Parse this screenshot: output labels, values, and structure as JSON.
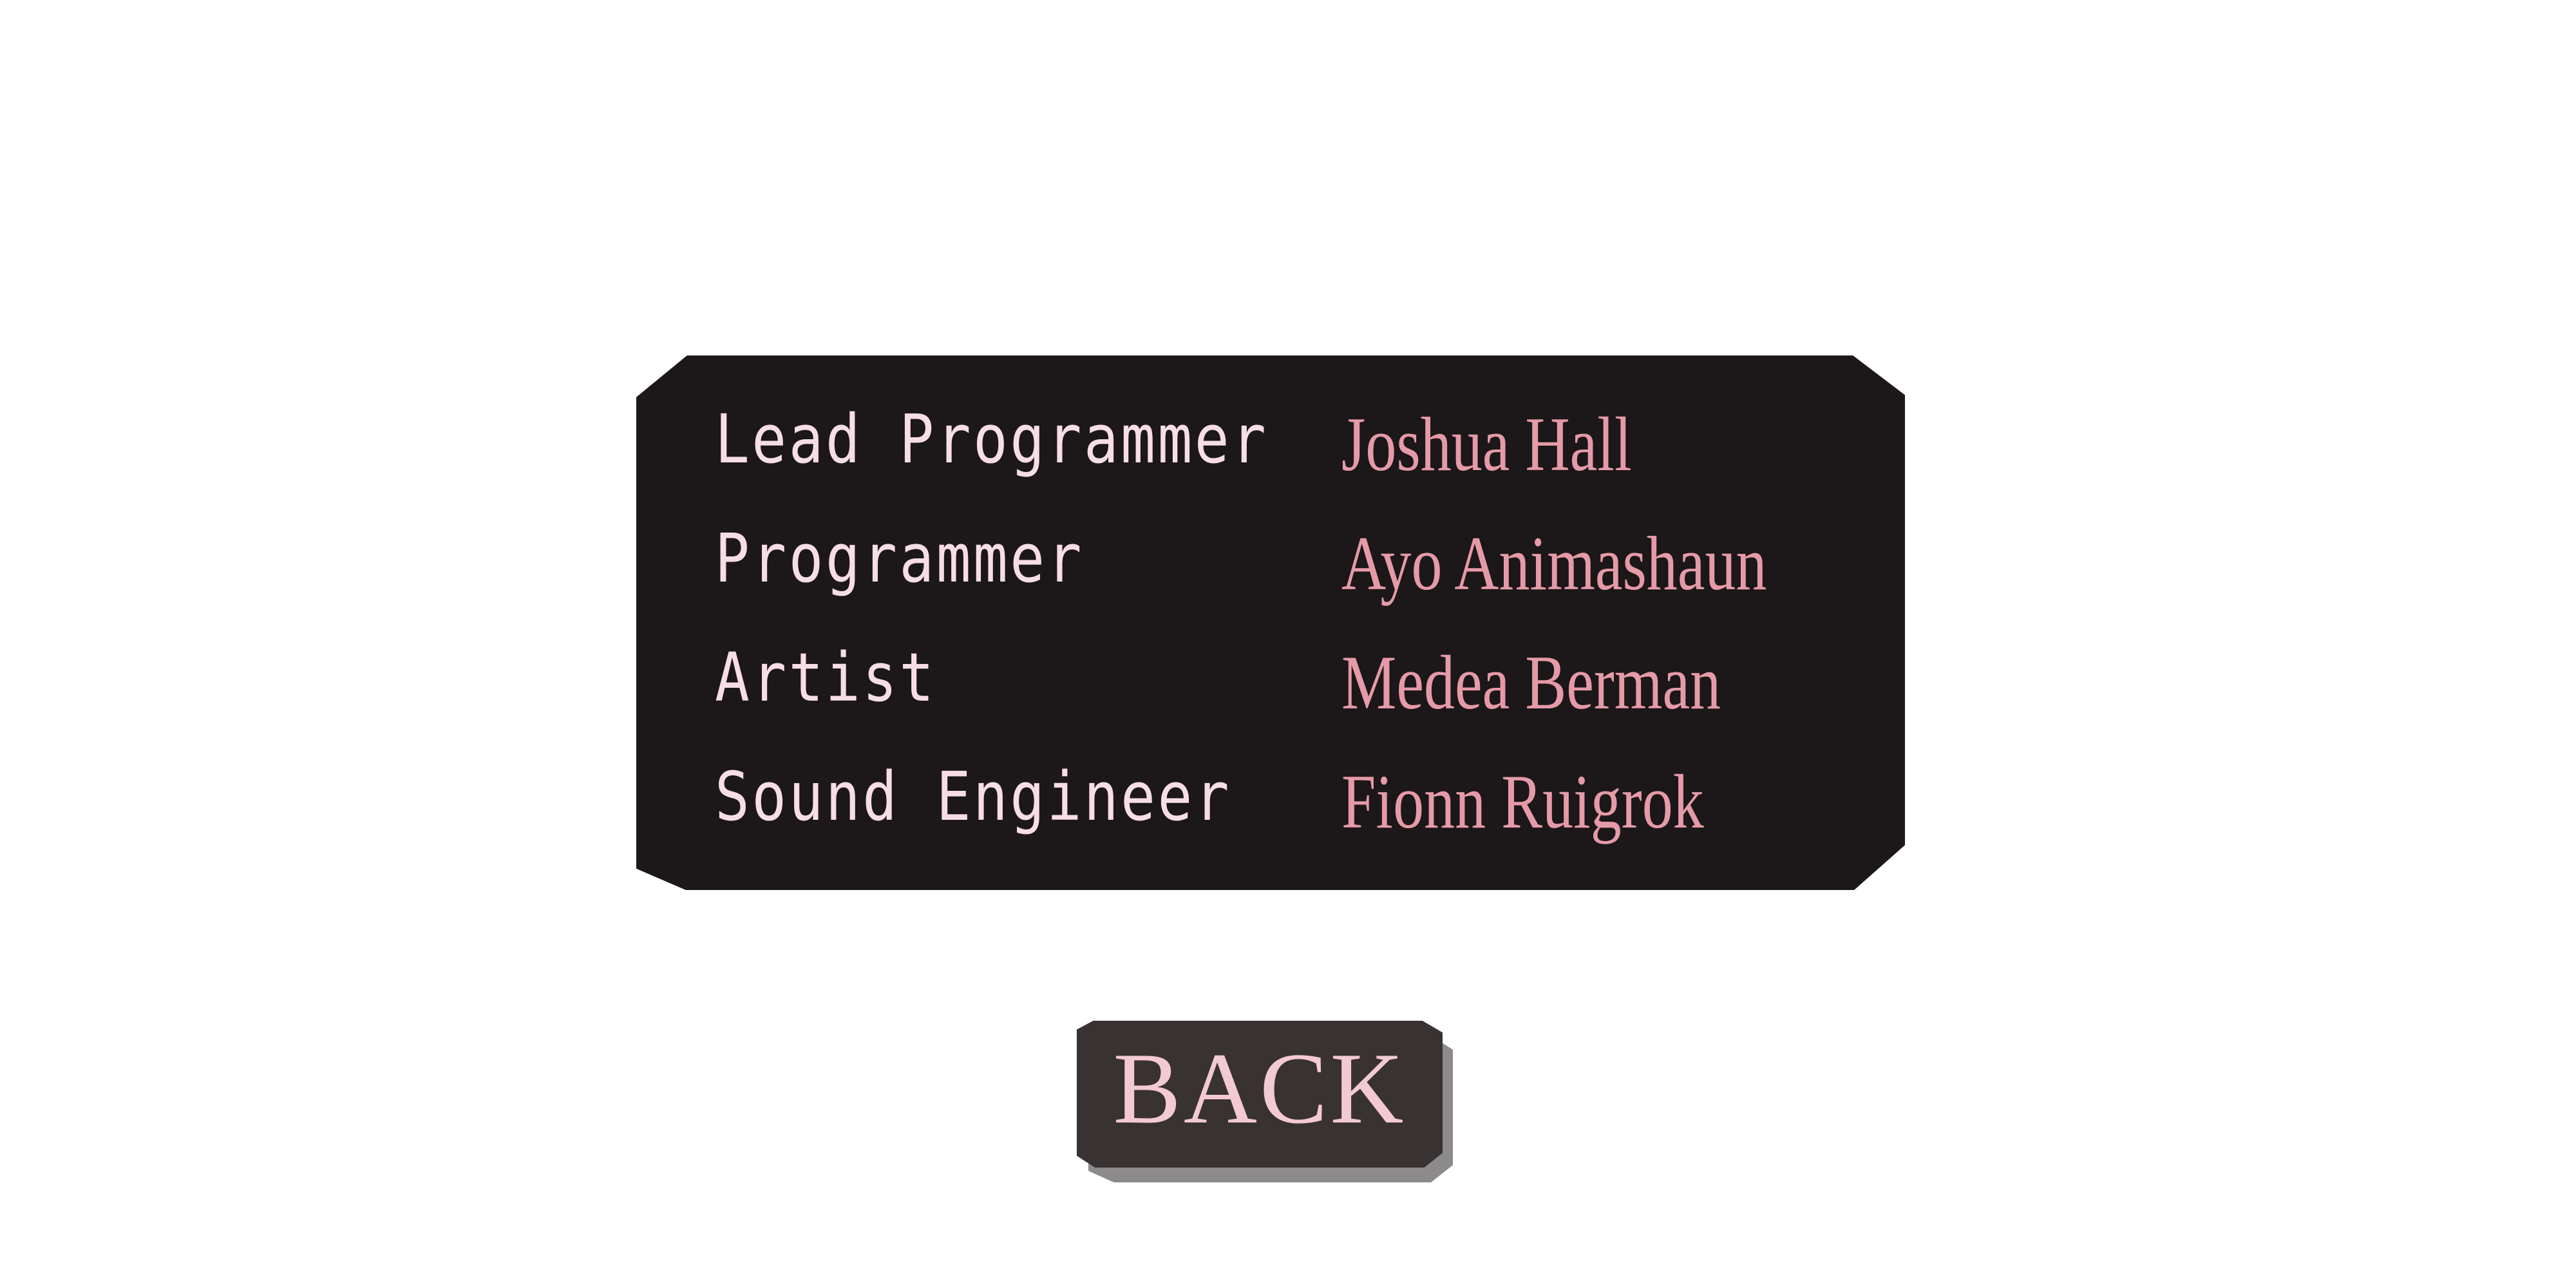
{
  "credits": [
    {
      "role": "Lead Programmer",
      "name": "Joshua Hall"
    },
    {
      "role": "Programmer",
      "name": "Ayo Animashaun"
    },
    {
      "role": "Artist",
      "name": "Medea Berman"
    },
    {
      "role": "Sound Engineer",
      "name": "Fionn Ruigrok"
    }
  ],
  "back_button": {
    "label": "BACK"
  },
  "colors": {
    "background": "#ffffff",
    "panel": "#1c1718",
    "role_text": "#f6dee4",
    "name_text": "#e59aa7",
    "button": "#393233",
    "button_shadow": "#8d8a8b",
    "button_text": "#f3c9d2"
  }
}
